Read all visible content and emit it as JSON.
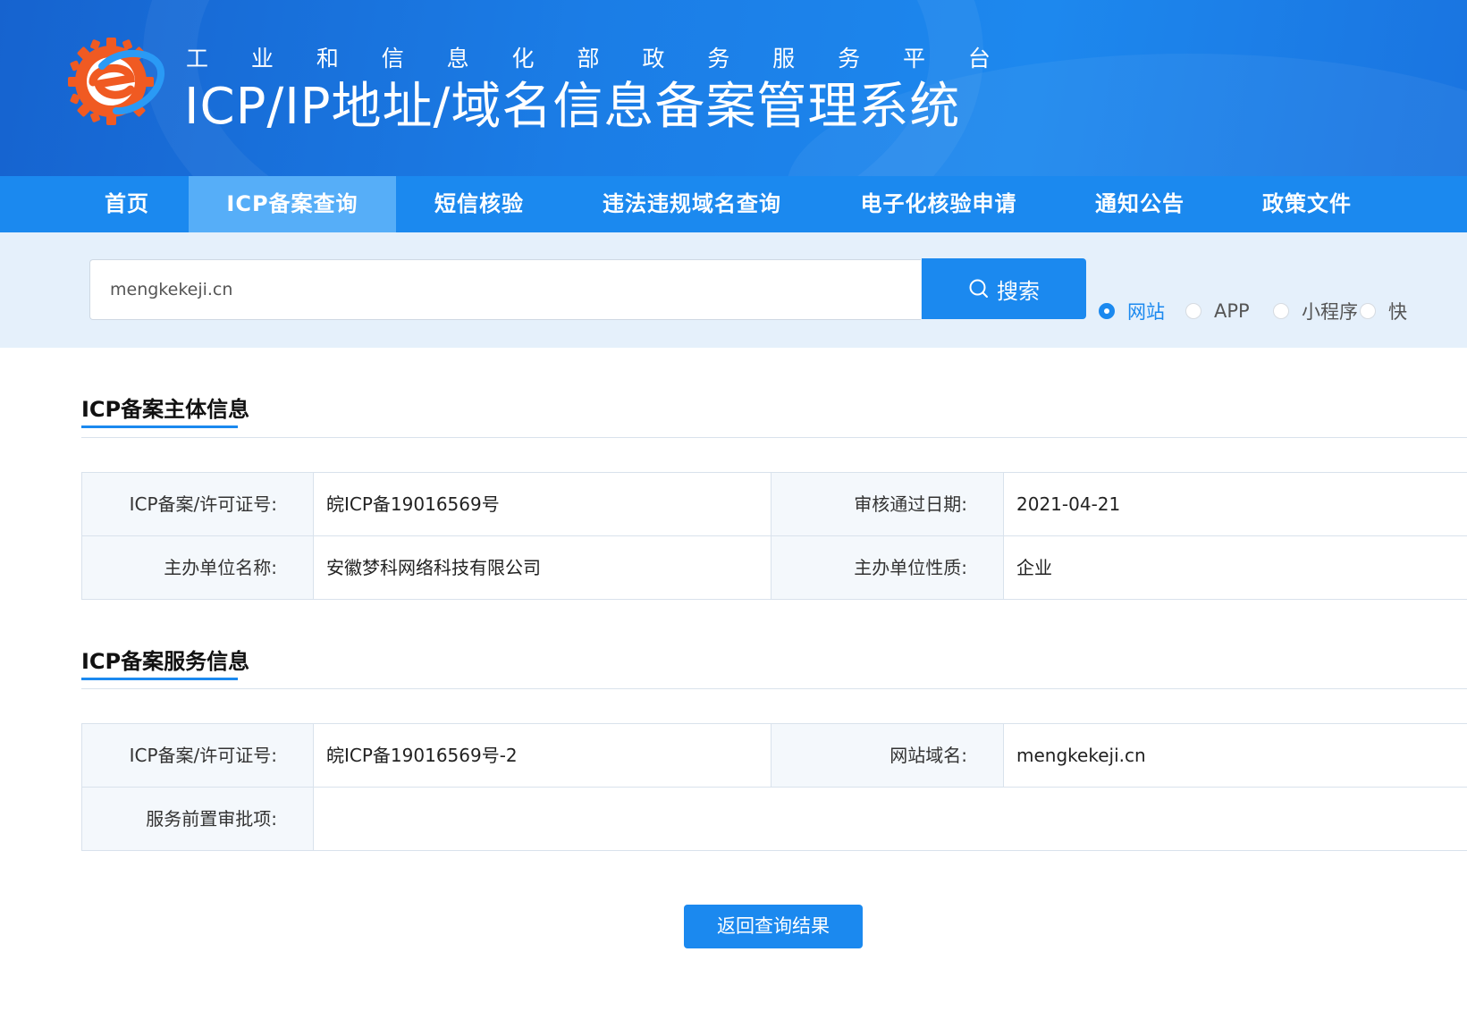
{
  "header": {
    "subtitle_chars": [
      "工",
      "业",
      "和",
      "信",
      "息",
      "化",
      "部",
      "政",
      "务",
      "服",
      "务",
      "平",
      "台"
    ],
    "title": "ICP/IP地址/域名信息备案管理系统",
    "logo_icon": "miit-e-gear-logo"
  },
  "nav": {
    "items": [
      "首页",
      "ICP备案查询",
      "短信核验",
      "违法违规域名查询",
      "电子化核验申请",
      "通知公告",
      "政策文件"
    ],
    "active": "ICP备案查询"
  },
  "search": {
    "value": "mengkekeji.cn",
    "button_label": "搜索",
    "button_icon": "search-icon",
    "types": [
      "网站",
      "APP",
      "小程序",
      "快"
    ],
    "selected_type": "网站"
  },
  "subject_info": {
    "title": "ICP备案主体信息",
    "rows": [
      {
        "label1": "ICP备案/许可证号:",
        "value1": "皖ICP备19016569号",
        "label2": "审核通过日期:",
        "value2": "2021-04-21"
      },
      {
        "label1": "主办单位名称:",
        "value1": "安徽梦科网络科技有限公司",
        "label2": "主办单位性质:",
        "value2": "企业"
      }
    ]
  },
  "service_info": {
    "title": "ICP备案服务信息",
    "rows": [
      {
        "label1": "ICP备案/许可证号:",
        "value1": "皖ICP备19016569号-2",
        "label2": "网站域名:",
        "value2": "mengkekeji.cn"
      },
      {
        "label1": "服务前置审批项:",
        "value1": ""
      }
    ]
  },
  "back_button_label": "返回查询结果",
  "colors": {
    "primary": "#1b89ef",
    "nav_active": "#56aef8",
    "search_band": "#e5f0fb",
    "logo_orange": "#f05a22"
  }
}
